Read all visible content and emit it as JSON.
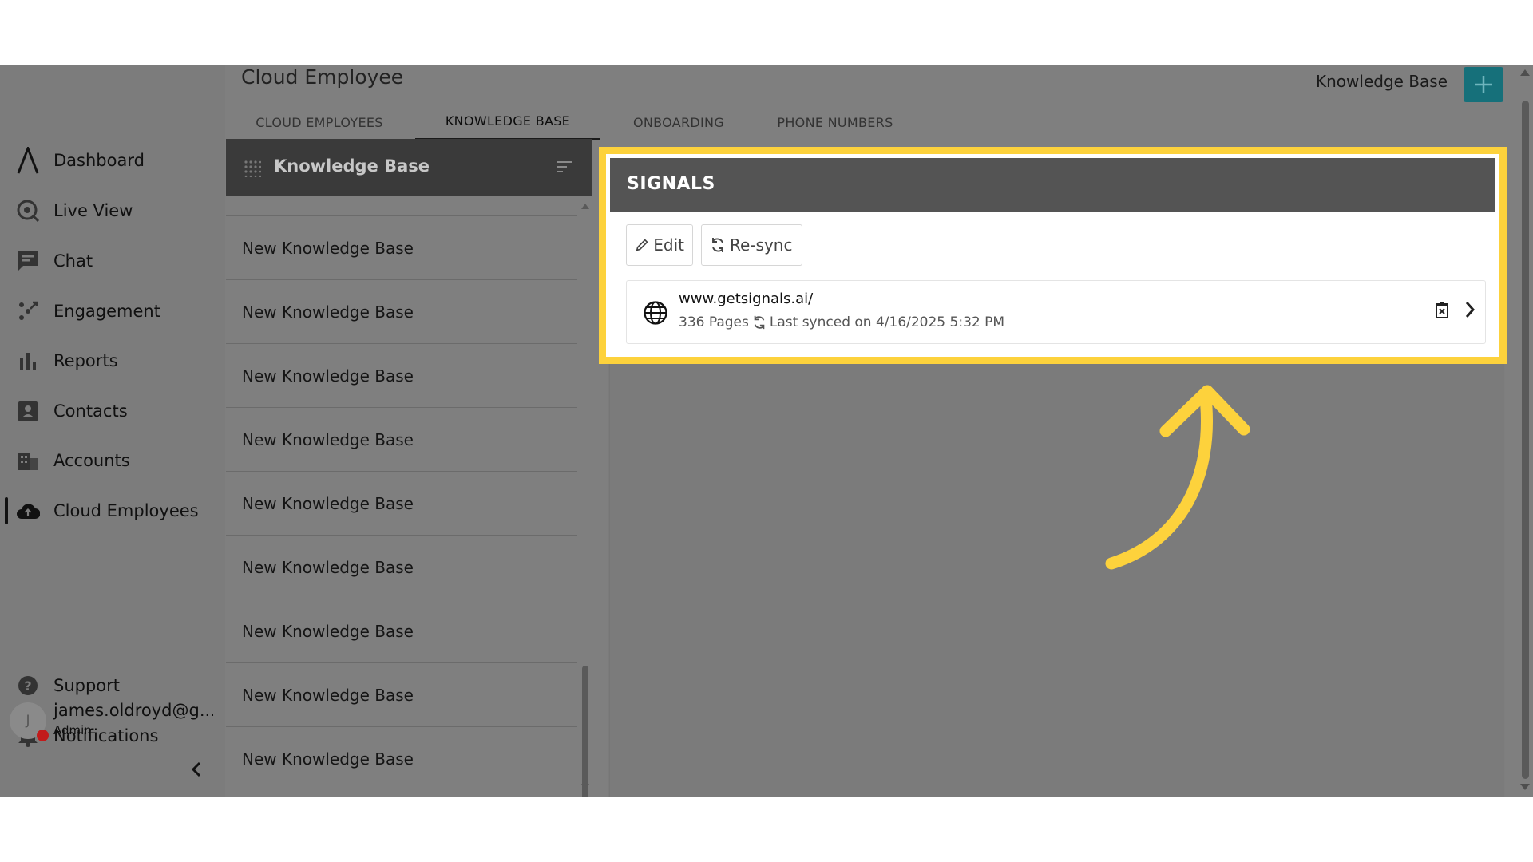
{
  "sidebar": {
    "items": [
      {
        "label": "Dashboard",
        "icon": "logo-icon"
      },
      {
        "label": "Live View",
        "icon": "live-view-icon"
      },
      {
        "label": "Chat",
        "icon": "chat-icon"
      },
      {
        "label": "Engagement",
        "icon": "engagement-icon"
      },
      {
        "label": "Reports",
        "icon": "reports-icon"
      },
      {
        "label": "Contacts",
        "icon": "contacts-icon"
      },
      {
        "label": "Accounts",
        "icon": "accounts-icon"
      },
      {
        "label": "Cloud Employees",
        "icon": "cloud-icon",
        "active": true
      }
    ],
    "bottom_items": [
      {
        "label": "Support",
        "icon": "help-icon"
      },
      {
        "label": "Notifications",
        "icon": "bell-icon"
      }
    ],
    "user": {
      "initial": "J",
      "email": "james.oldroyd@g...",
      "role": "Admin"
    }
  },
  "header": {
    "title": "Cloud Employee",
    "section_label": "Knowledge Base",
    "tabs": [
      {
        "label": "CLOUD EMPLOYEES"
      },
      {
        "label": "KNOWLEDGE BASE",
        "active": true
      },
      {
        "label": "ONBOARDING"
      },
      {
        "label": "PHONE NUMBERS"
      }
    ]
  },
  "list": {
    "title": "Knowledge Base",
    "items": [
      "New Knowledge Base",
      "New Knowledge Base",
      "New Knowledge Base",
      "New Knowledge Base",
      "New Knowledge Base",
      "New Knowledge Base",
      "New Knowledge Base",
      "New Knowledge Base",
      "New Knowledge Base"
    ]
  },
  "detail": {
    "title": "SIGNALS",
    "edit_label": "Edit",
    "resync_label": "Re-sync",
    "source": {
      "url": "www.getsignals.ai/",
      "pages": "336 Pages",
      "last_synced": "Last synced on 4/16/2025 5:32 PM"
    }
  },
  "colors": {
    "highlight": "#fdd23c",
    "accent": "#16707a",
    "overlay": "#7f7f7f"
  }
}
